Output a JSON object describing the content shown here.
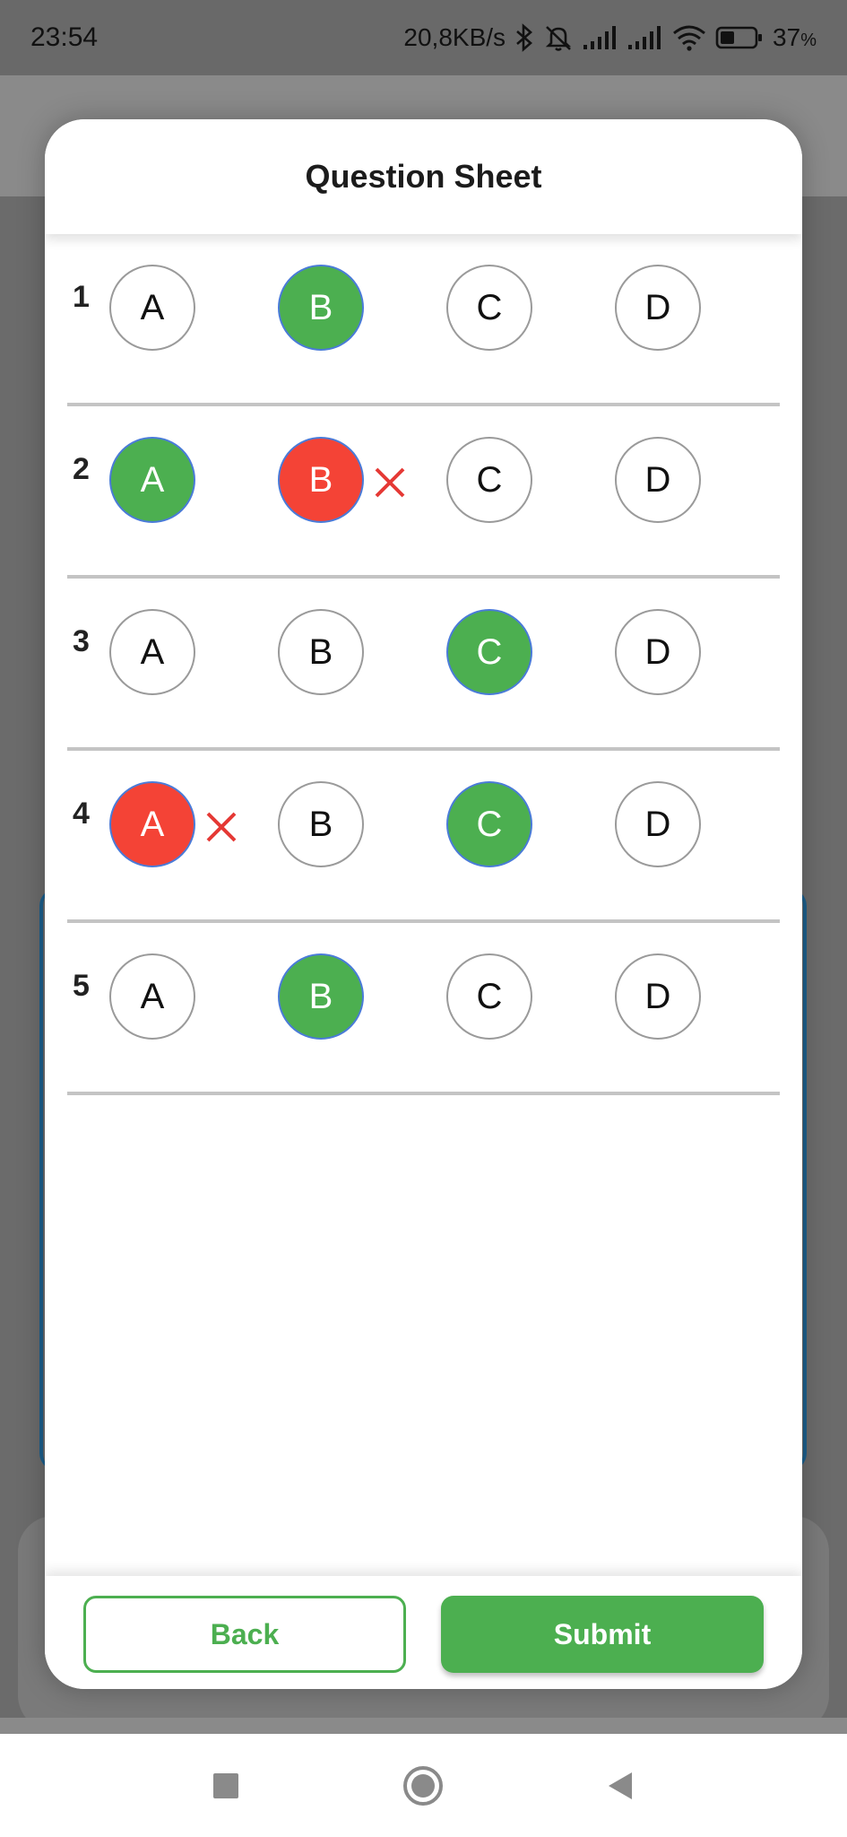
{
  "status_bar": {
    "time": "23:54",
    "network_speed": "20,8KB/s",
    "battery_percent": "37",
    "battery_unit": "%",
    "icons": [
      "bluetooth-icon",
      "mute-icon",
      "signal-icon",
      "signal-icon",
      "wifi-icon",
      "battery-icon"
    ]
  },
  "modal": {
    "title": "Question Sheet",
    "questions": [
      {
        "number": "1",
        "options": [
          "A",
          "B",
          "C",
          "D"
        ],
        "correct": "B",
        "wrong": null
      },
      {
        "number": "2",
        "options": [
          "A",
          "B",
          "C",
          "D"
        ],
        "correct": "A",
        "wrong": "B"
      },
      {
        "number": "3",
        "options": [
          "A",
          "B",
          "C",
          "D"
        ],
        "correct": "C",
        "wrong": null
      },
      {
        "number": "4",
        "options": [
          "A",
          "B",
          "C",
          "D"
        ],
        "correct": "C",
        "wrong": "A"
      },
      {
        "number": "5",
        "options": [
          "A",
          "B",
          "C",
          "D"
        ],
        "correct": "B",
        "wrong": null
      }
    ],
    "back_label": "Back",
    "submit_label": "Submit"
  },
  "colors": {
    "correct": "#4caf50",
    "wrong": "#f44336",
    "wrong_mark": "#e53935",
    "selected_border": "#4a7bd8"
  },
  "nav_bar": {
    "icons": [
      "recent-apps-icon",
      "home-icon",
      "back-icon"
    ]
  }
}
